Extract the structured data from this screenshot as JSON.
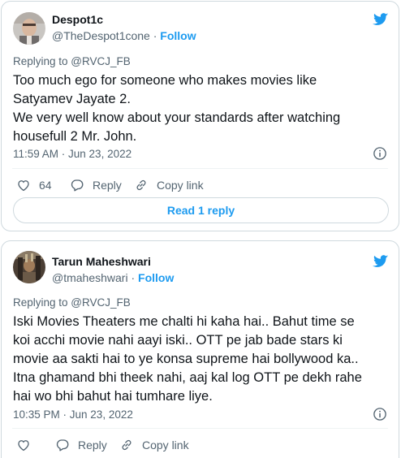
{
  "tweets": [
    {
      "name": "Despot1c",
      "handle": "@TheDespot1cone",
      "separator": " · ",
      "follow": "Follow",
      "replying": "Replying to @RVCJ_FB",
      "lines": [
        "Too much ego for someone who makes movies like",
        "Satyamev Jayate 2.",
        "We very well know about your standards after watching",
        "housefull 2 Mr. John."
      ],
      "timestamp": "11:59 AM · Jun 23, 2022",
      "likes": "64",
      "reply_label": "Reply",
      "copy_label": "Copy link",
      "read_reply": "Read 1 reply"
    },
    {
      "name": "Tarun Maheshwari",
      "handle": "@tmaheshwari",
      "separator": " · ",
      "follow": "Follow",
      "replying": "Replying to @RVCJ_FB",
      "lines": [
        "Iski Movies Theaters me chalti hi kaha hai.. Bahut time se",
        "koi acchi movie nahi aayi iski.. OTT pe jab bade stars ki",
        "movie aa sakti hai to ye konsa supreme hai bollywood ka..",
        "Itna ghamand bhi theek nahi, aaj kal log OTT pe dekh rahe",
        "hai wo bhi bahut hai tumhare liye."
      ],
      "timestamp": "10:35 PM · Jun 23, 2022",
      "reply_label": "Reply",
      "copy_label": "Copy link"
    }
  ],
  "colors": {
    "accent": "#1d9bf0",
    "secondary_text": "#536471",
    "border": "#cfd9de"
  },
  "icons": [
    "twitter-bird-icon",
    "heart-icon",
    "reply-bubble-icon",
    "link-icon",
    "info-icon"
  ]
}
